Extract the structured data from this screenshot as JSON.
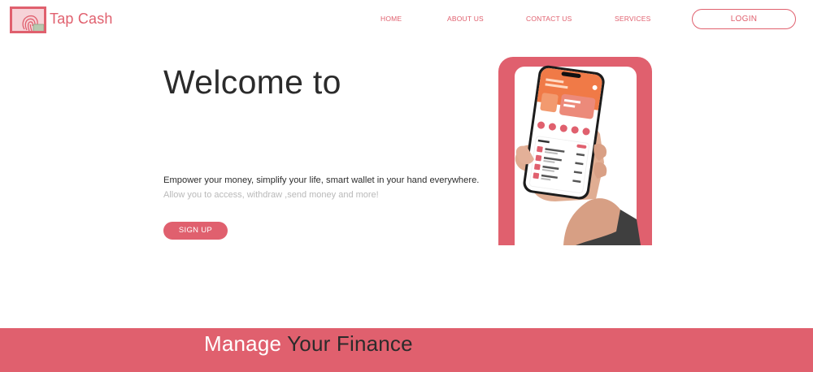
{
  "brand": {
    "name": "Tap Cash",
    "logo_icon": "fingerprint-card-icon"
  },
  "nav": {
    "home": "HOME",
    "about": "ABOUT US",
    "contact": "CONTACT US",
    "services": "SERVICES",
    "login": "LOGIN"
  },
  "hero": {
    "title": "Welcome to",
    "tagline": "Empower your money, simplify your life, smart wallet in your hand everywhere.",
    "subtagline": "Allow you to access, withdraw ,send money and more!",
    "cta": "SIGN UP",
    "illustration": "hand-holding-phone-illustration"
  },
  "banner": {
    "word1": "Manage",
    "word2": "Your Finance"
  },
  "colors": {
    "accent": "#e0606e",
    "text": "#2b2b2b",
    "muted": "#b9b9b9",
    "background": "#ffffff"
  }
}
